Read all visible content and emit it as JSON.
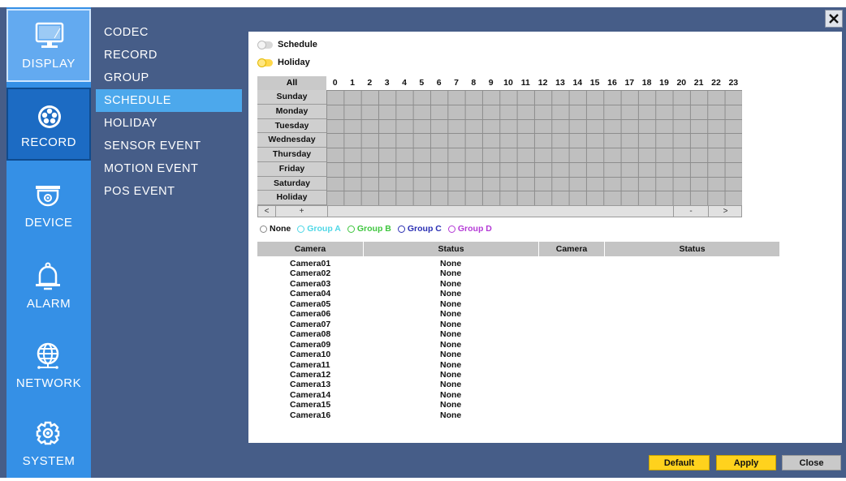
{
  "close_icon": "close-icon",
  "nav": {
    "items": [
      {
        "id": "display",
        "label": "DISPLAY",
        "icon": "monitor-icon"
      },
      {
        "id": "record",
        "label": "RECORD",
        "icon": "film-reel-icon"
      },
      {
        "id": "device",
        "label": "DEVICE",
        "icon": "dome-camera-icon"
      },
      {
        "id": "alarm",
        "label": "ALARM",
        "icon": "bell-icon"
      },
      {
        "id": "network",
        "label": "NETWORK",
        "icon": "globe-icon"
      },
      {
        "id": "system",
        "label": "SYSTEM",
        "icon": "gear-icon"
      }
    ]
  },
  "submenu": {
    "items": [
      "CODEC",
      "RECORD",
      "GROUP",
      "SCHEDULE",
      "HOLIDAY",
      "SENSOR EVENT",
      "MOTION EVENT",
      "POS EVENT"
    ],
    "active": "SCHEDULE"
  },
  "mode": {
    "schedule_label": "Schedule",
    "holiday_label": "Holiday",
    "schedule_on": false,
    "holiday_on": true
  },
  "grid": {
    "all_label": "All",
    "hours": [
      "0",
      "1",
      "2",
      "3",
      "4",
      "5",
      "6",
      "7",
      "8",
      "9",
      "10",
      "11",
      "12",
      "13",
      "14",
      "15",
      "16",
      "17",
      "18",
      "19",
      "20",
      "21",
      "22",
      "23"
    ],
    "days": [
      "Sunday",
      "Monday",
      "Tuesday",
      "Wednesday",
      "Thursday",
      "Friday",
      "Saturday",
      "Holiday"
    ],
    "scroll": {
      "left": "<",
      "plus": "+",
      "minus": "-",
      "right": ">"
    }
  },
  "legend": [
    {
      "label": "None",
      "color": "#111111",
      "circle": "#888888"
    },
    {
      "label": "Group A",
      "color": "#4fd7e6",
      "circle": "#4fd7e6"
    },
    {
      "label": "Group B",
      "color": "#3fc63f",
      "circle": "#3fc63f"
    },
    {
      "label": "Group C",
      "color": "#2a2fb3",
      "circle": "#2a2fb3"
    },
    {
      "label": "Group D",
      "color": "#b43ad6",
      "circle": "#b43ad6"
    }
  ],
  "table": {
    "headers": [
      "Camera",
      "Status",
      "Camera",
      "Status"
    ],
    "rows": [
      {
        "camera": "Camera01",
        "status": "None"
      },
      {
        "camera": "Camera02",
        "status": "None"
      },
      {
        "camera": "Camera03",
        "status": "None"
      },
      {
        "camera": "Camera04",
        "status": "None"
      },
      {
        "camera": "Camera05",
        "status": "None"
      },
      {
        "camera": "Camera06",
        "status": "None"
      },
      {
        "camera": "Camera07",
        "status": "None"
      },
      {
        "camera": "Camera08",
        "status": "None"
      },
      {
        "camera": "Camera09",
        "status": "None"
      },
      {
        "camera": "Camera10",
        "status": "None"
      },
      {
        "camera": "Camera11",
        "status": "None"
      },
      {
        "camera": "Camera12",
        "status": "None"
      },
      {
        "camera": "Camera13",
        "status": "None"
      },
      {
        "camera": "Camera14",
        "status": "None"
      },
      {
        "camera": "Camera15",
        "status": "None"
      },
      {
        "camera": "Camera16",
        "status": "None"
      }
    ]
  },
  "buttons": {
    "default": "Default",
    "apply": "Apply",
    "close": "Close"
  },
  "colors": {
    "frame": "#465d88",
    "iconbar": "#3590e6",
    "submenu_active": "#4ca8ec",
    "button_yellow": "#ffd21d"
  }
}
